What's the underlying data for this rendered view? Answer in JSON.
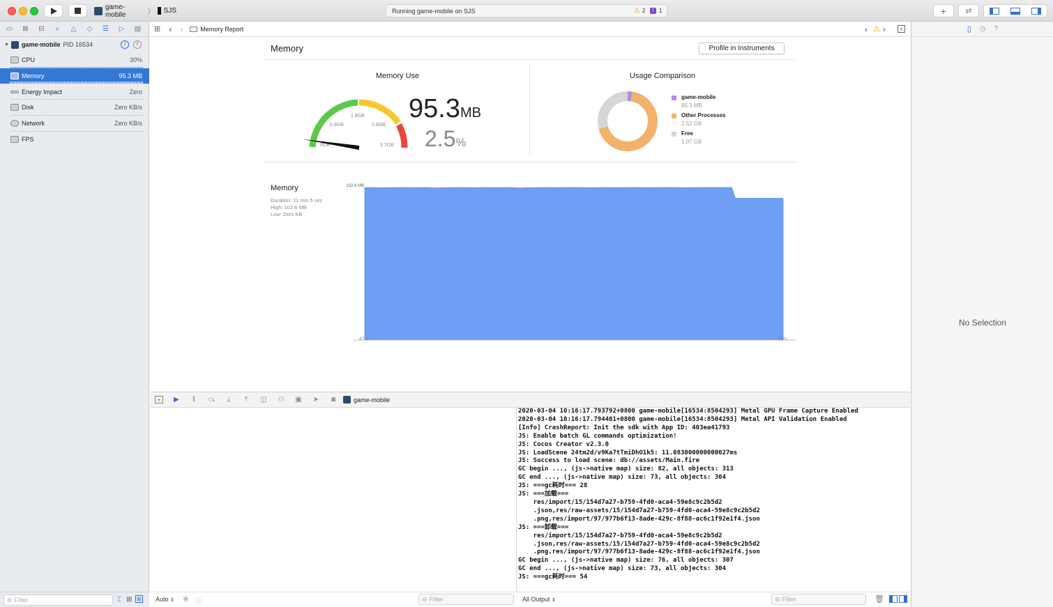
{
  "toolbar": {
    "scheme_app": "game-mobile",
    "scheme_device": "SJS",
    "activity_text": "Running game-mobile on SJS",
    "warning_count": "2",
    "issue_count": "1"
  },
  "navigator": {
    "process_name": "game-mobile",
    "process_pid": "PID 16534",
    "gauges": [
      {
        "label": "CPU",
        "value": "30%"
      },
      {
        "label": "Memory",
        "value": "95.3 MB"
      },
      {
        "label": "Energy Impact",
        "value": "Zero"
      },
      {
        "label": "Disk",
        "value": "Zero KB/s"
      },
      {
        "label": "Network",
        "value": "Zero KB/s"
      },
      {
        "label": "FPS",
        "value": ""
      }
    ],
    "filter_placeholder": "Filter"
  },
  "jumpbar": {
    "path": "Memory Report"
  },
  "report": {
    "title": "Memory",
    "profile_button": "Profile in Instruments",
    "memory_use_title": "Memory Use",
    "usage_value": "95.3",
    "usage_unit": "MB",
    "percent_value": "2.5",
    "percent_unit": "%",
    "gauge_labels": [
      "0.9GB",
      "1.8GB",
      "2.8GB",
      "3.7GB",
      "0GB"
    ],
    "gauge_fraction": 0.025,
    "comparison_title": "Usage Comparison",
    "legend": [
      {
        "name": "game-mobile",
        "value": "95.3 MB",
        "color": "#b48de0"
      },
      {
        "name": "Other Processes",
        "value": "2.52 GB",
        "color": "#f2b26a"
      },
      {
        "name": "Free",
        "value": "1.07 GB",
        "color": "#d6d6d6"
      }
    ],
    "donut_values": [
      95.3,
      2580,
      1095
    ],
    "graph": {
      "title": "Memory",
      "duration": "Duration: 11 min 5 sec",
      "high": "High: 102.6 MB",
      "low": "Low: Zero KB",
      "y_top_label": "102.6 MB",
      "x_start_label": "472s",
      "x_end_label": "662s"
    }
  },
  "chart_data": {
    "type": "area",
    "title": "Memory",
    "x_start": "472s",
    "x_end": "662s",
    "ylim": [
      0,
      102.6
    ],
    "values": [
      102.6,
      102.4,
      102.5,
      102.6,
      102.5,
      102.6,
      102.3,
      102.5,
      102.6,
      102.4,
      102.6,
      102.5,
      102.6,
      102.3,
      102.5,
      102.6,
      102.5,
      102.6,
      102.6,
      102.4,
      102.6,
      102.5,
      102.6,
      102.6,
      102.5,
      102.6,
      102.6,
      102.4,
      102.6,
      102.6,
      102.6,
      95.3,
      95.3,
      95.3,
      95.3,
      95.3
    ]
  },
  "debugbar": {
    "process": "game-mobile"
  },
  "console": {
    "lines": [
      "2020-03-04 10:16:17.793792+0800 game-mobile[16534:8504293] Metal GPU Frame Capture Enabled",
      "2020-03-04 10:16:17.794401+0800 game-mobile[16534:8504293] Metal API Validation Enabled",
      "[Info] CrashReport: Init the sdk with App ID: 403ea41793",
      "JS: Enable batch GL commands optimization!",
      "JS: Cocos Creator v2.3.0",
      "JS: LoadScene 24tm2d/v9Ka7tTmiDhO1k5: 11.083000000000027ms",
      "JS: Success to load scene: db://assets/Main.fire",
      "GC begin ..., (js->native map) size: 82, all objects: 313",
      "GC end ..., (js->native map) size: 73, all objects: 304",
      "JS: ===gc耗时=== 28",
      "JS: ===加载===",
      "    res/import/15/154d7a27-b759-4fd0-aca4-59e8c9c2b5d2",
      "    .json,res/raw-assets/15/154d7a27-b759-4fd0-aca4-59e8c9c2b5d2",
      "    .png,res/import/97/977b6f13-8ade-429c-8f88-ac6c1f92e1f4.json",
      "JS: ===卸载===",
      "    res/import/15/154d7a27-b759-4fd0-aca4-59e8c9c2b5d2",
      "    .json,res/raw-assets/15/154d7a27-b759-4fd0-aca4-59e8c9c2b5d2",
      "    .png,res/import/97/977b6f13-8ade-429c-8f88-ac6c1f92e1f4.json",
      "GC begin ..., (js->native map) size: 76, all objects: 307",
      "GC end ..., (js->native map) size: 73, all objects: 304",
      "JS: ===gc耗时=== 54"
    ]
  },
  "bottom": {
    "auto_label": "Auto",
    "left_filter": "Filter",
    "output_label": "All Output",
    "right_filter": "Filter"
  },
  "inspector": {
    "empty_text": "No Selection"
  },
  "colors": {
    "selection": "#3478d6",
    "graph_fill": "#6f9ef5",
    "gauge_green": "#5cc94a",
    "gauge_yellow": "#f5c830",
    "gauge_red": "#e8463a"
  }
}
